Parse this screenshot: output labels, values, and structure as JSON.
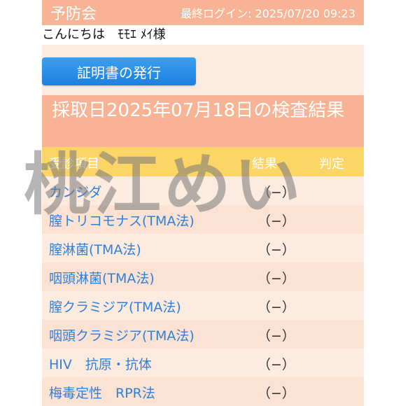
{
  "header": {
    "brand": "予防会",
    "last_login": "最終ログイン: 2025/07/20 09:23"
  },
  "greeting": "こんにちは　ﾓﾓｴ ﾒｲ様",
  "certificate_button": "証明書の発行",
  "result_title": "採取日2025年07月18日の検査結果",
  "table": {
    "headers": [
      "受診項目",
      "結果",
      "判定"
    ],
    "rows": [
      {
        "name": "カンジダ",
        "result": "（−）"
      },
      {
        "name": "膣トリコモナス(TMA法)",
        "result": "（−）"
      },
      {
        "name": "膣淋菌(TMA法)",
        "result": "（−）"
      },
      {
        "name": "咽頭淋菌(TMA法)",
        "result": "（−）"
      },
      {
        "name": "膣クラミジア(TMA法)",
        "result": "（−）"
      },
      {
        "name": "咽頭クラミジア(TMA法)",
        "result": "（−）"
      },
      {
        "name": "HIV　抗原・抗体",
        "result": "（−）"
      },
      {
        "name": "梅毒定性　RPR法",
        "result": "（−）"
      }
    ]
  },
  "overlay_text": "桃江めい",
  "colors": {
    "header_bg": "#f7b394",
    "table_header_bg": "#fbd667",
    "button_bg": "#1f7fe0",
    "item_text": "#2f80d8"
  }
}
